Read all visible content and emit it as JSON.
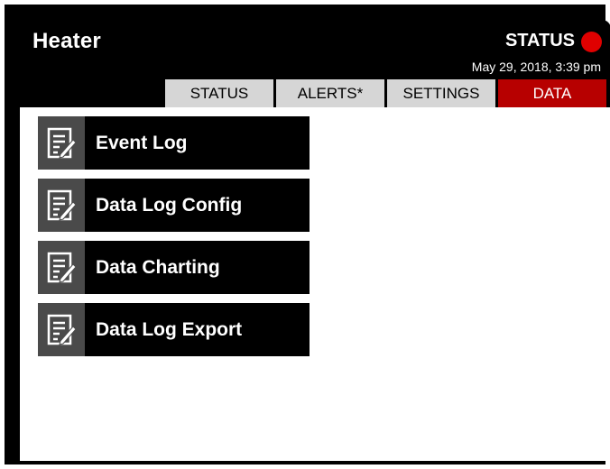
{
  "header": {
    "title": "Heater",
    "status_label": "STATUS",
    "status_color": "#e00000",
    "datetime": "May 29, 2018, 3:39 pm"
  },
  "tabs": [
    {
      "label": "STATUS",
      "active": false
    },
    {
      "label": "ALERTS*",
      "active": false
    },
    {
      "label": "SETTINGS",
      "active": false
    },
    {
      "label": "DATA",
      "active": true
    }
  ],
  "menu": [
    {
      "label": "Event Log",
      "icon": "note-edit-icon"
    },
    {
      "label": "Data Log Config",
      "icon": "note-edit-icon"
    },
    {
      "label": "Data Charting",
      "icon": "note-edit-icon"
    },
    {
      "label": "Data Log Export",
      "icon": "note-edit-icon"
    }
  ],
  "colors": {
    "accent": "#b70000",
    "tab_inactive": "#d6d6d6",
    "button_bg": "#000000",
    "icon_bg": "#4a4a4a"
  }
}
